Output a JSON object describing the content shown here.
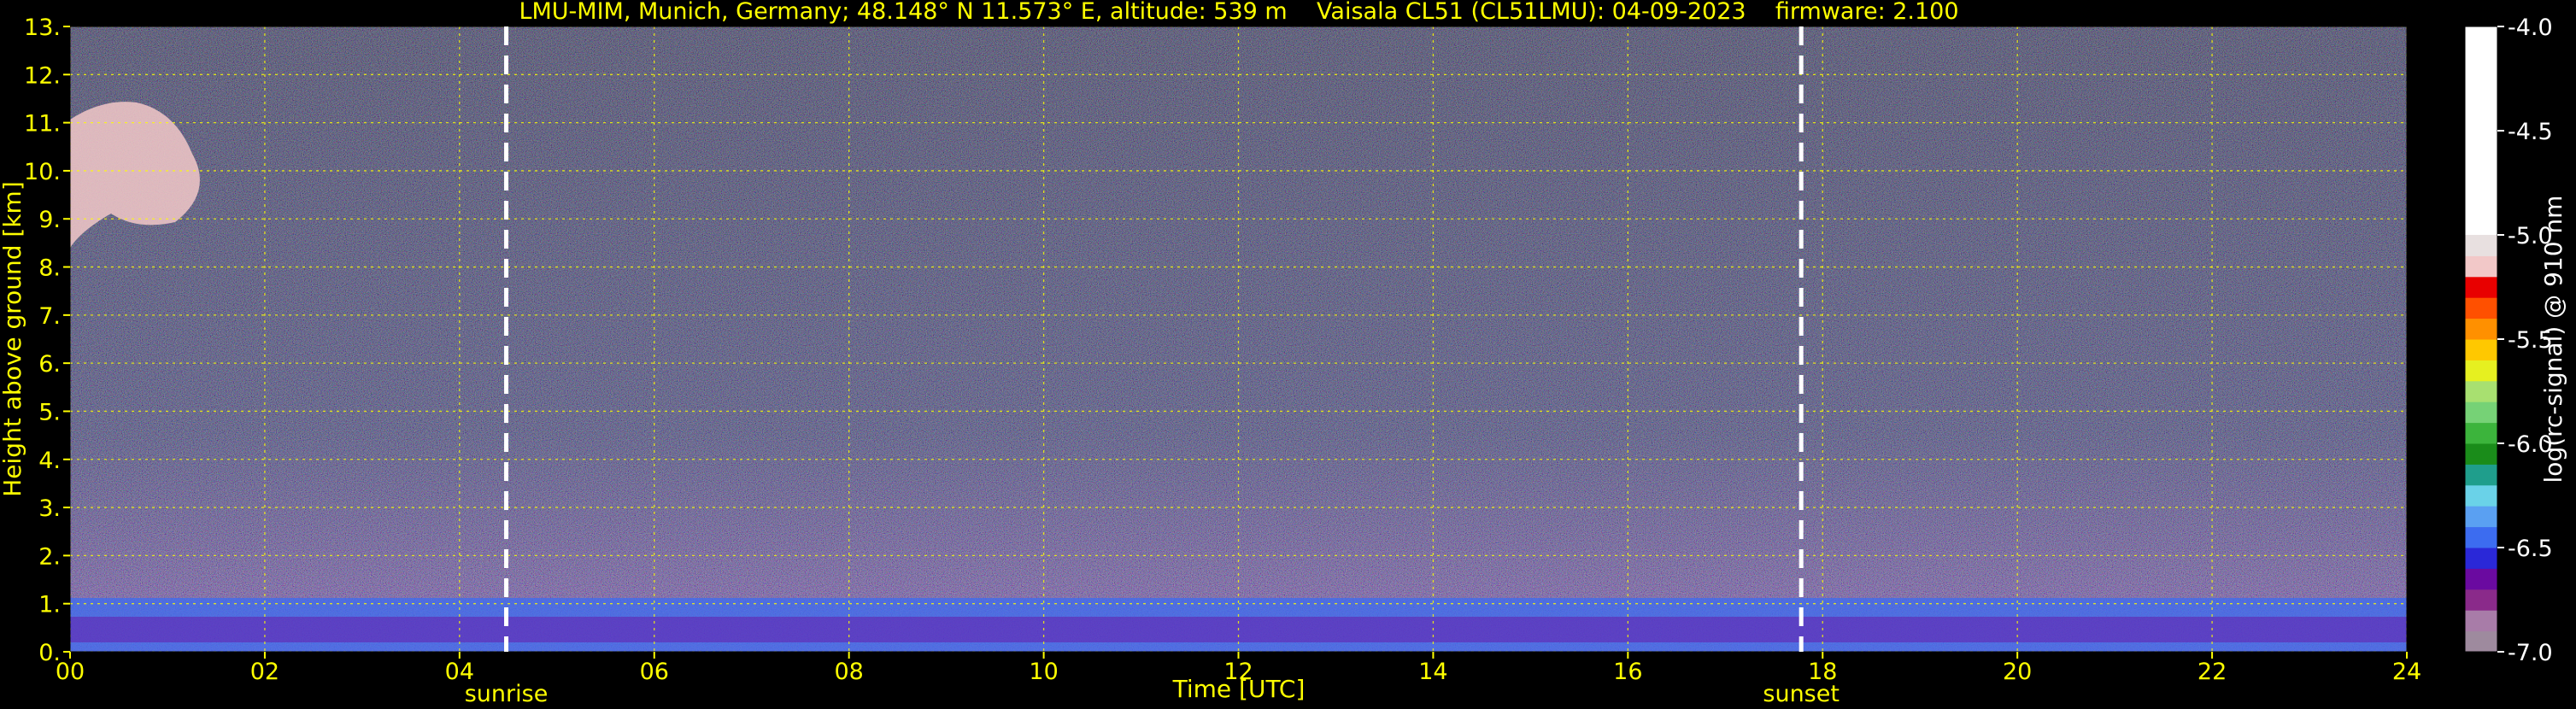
{
  "chart_data": {
    "type": "heatmap",
    "title": "LMU-MIM, Munich, Germany; 48.148° N 11.573° E, altitude: 539 m    Vaisala CL51 (CL51LMU): 04-09-2023    firmware: 2.100",
    "xlabel": "Time [UTC]",
    "ylabel": "Height above ground [km]",
    "xlim": [
      0,
      24
    ],
    "ylim": [
      0,
      13
    ],
    "x_ticks": [
      0,
      2,
      4,
      6,
      8,
      10,
      12,
      14,
      16,
      18,
      20,
      22,
      24
    ],
    "x_tick_labels": [
      "00",
      "02",
      "04",
      "06",
      "08",
      "10",
      "12",
      "14",
      "16",
      "18",
      "20",
      "22",
      "24"
    ],
    "y_ticks": [
      0,
      1,
      2,
      3,
      4,
      5,
      6,
      7,
      8,
      9,
      10,
      11,
      12,
      13
    ],
    "y_tick_labels": [
      "0.",
      "1.",
      "2.",
      "3.",
      "4.",
      "5.",
      "6.",
      "7.",
      "8.",
      "9.",
      "10.",
      "11.",
      "12.",
      "13."
    ],
    "grid": true,
    "events": [
      {
        "label": "sunrise",
        "time": 4.48
      },
      {
        "label": "sunset",
        "time": 17.78
      }
    ],
    "colorbar": {
      "label": "log(rc-signal) @ 910 nm",
      "range": [
        -7.0,
        -4.0
      ],
      "ticks": [
        -4.0,
        -4.5,
        -5.0,
        -5.5,
        -6.0,
        -6.5,
        -7.0
      ],
      "tick_labels": [
        "-4.0",
        "-4.5",
        "-5.0",
        "-5.5",
        "-6.0",
        "-6.5",
        "-7.0"
      ]
    }
  },
  "colors": {
    "background": "#000000",
    "text": "#ffff00",
    "grid": "#ffff00",
    "event_line": "#ffffff",
    "colorbar_text": "#ffffff",
    "colormap": [
      "#9e8a9e",
      "#a87ca8",
      "#8a2a8a",
      "#6a0aa0",
      "#2a28d8",
      "#3c6cf0",
      "#5aa0f2",
      "#6ad2e8",
      "#1f9e8c",
      "#1a8c1a",
      "#3cb43c",
      "#76d276",
      "#a8e070",
      "#e6f020",
      "#ffc800",
      "#ff9000",
      "#ff5000",
      "#e80000",
      "#f2c8c8",
      "#e8e0e0",
      "#ffffff"
    ]
  }
}
